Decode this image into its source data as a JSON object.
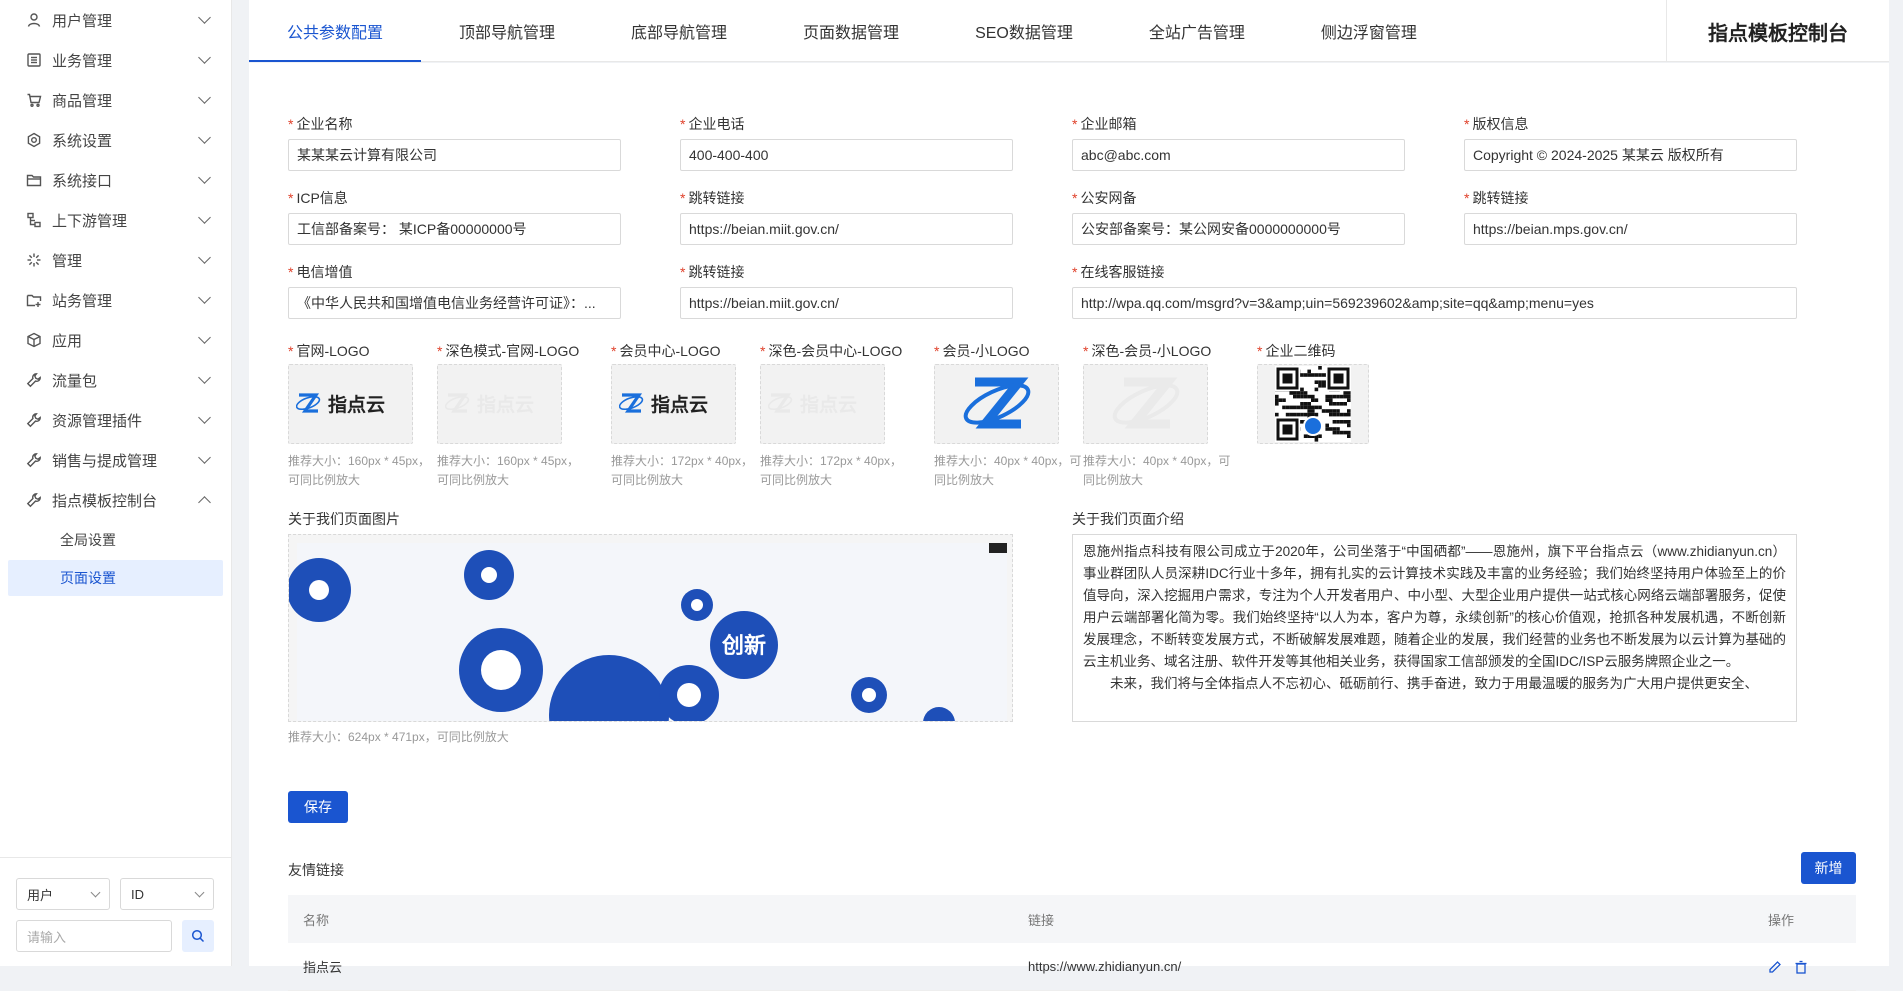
{
  "sidebar": {
    "items": [
      {
        "label": "用户管理",
        "icon": "user-icon"
      },
      {
        "label": "业务管理",
        "icon": "list-icon"
      },
      {
        "label": "商品管理",
        "icon": "cart-icon"
      },
      {
        "label": "系统设置",
        "icon": "settings-icon"
      },
      {
        "label": "系统接口",
        "icon": "folder-icon"
      },
      {
        "label": "上下游管理",
        "icon": "tree-icon"
      },
      {
        "label": "管理",
        "icon": "sparkle-icon"
      },
      {
        "label": "站务管理",
        "icon": "folder-plus-icon"
      },
      {
        "label": "应用",
        "icon": "cube-icon"
      },
      {
        "label": "流量包",
        "icon": "wrench-icon"
      },
      {
        "label": "资源管理插件",
        "icon": "wrench-icon"
      },
      {
        "label": "销售与提成管理",
        "icon": "wrench-icon"
      },
      {
        "label": "指点模板控制台",
        "icon": "wrench-icon"
      }
    ],
    "sub_items": [
      {
        "label": "全局设置"
      },
      {
        "label": "页面设置"
      }
    ],
    "filter": {
      "select1": "用户",
      "select2": "ID",
      "search_placeholder": "请输入"
    }
  },
  "tabs": [
    {
      "label": "公共参数配置"
    },
    {
      "label": "顶部导航管理"
    },
    {
      "label": "底部导航管理"
    },
    {
      "label": "页面数据管理"
    },
    {
      "label": "SEO数据管理"
    },
    {
      "label": "全站广告管理"
    },
    {
      "label": "侧边浮窗管理"
    }
  ],
  "console_title": "指点模板控制台",
  "form": {
    "company_name": {
      "label": "企业名称",
      "value": "某某某云计算有限公司"
    },
    "company_phone": {
      "label": "企业电话",
      "value": "400-400-400"
    },
    "company_email": {
      "label": "企业邮箱",
      "value": "abc@abc.com"
    },
    "copyright": {
      "label": "版权信息",
      "value": "Copyright © 2024-2025 某某云 版权所有"
    },
    "icp": {
      "label": "ICP信息",
      "value": "工信部备案号： 某ICP备00000000号"
    },
    "icp_link": {
      "label": "跳转链接",
      "value": "https://beian.miit.gov.cn/"
    },
    "police": {
      "label": "公安网备",
      "value": "公安部备案号：某公网安备0000000000号"
    },
    "police_link": {
      "label": "跳转链接",
      "value": "https://beian.mps.gov.cn/"
    },
    "telecom": {
      "label": "电信增值",
      "value": "《中华人民共和国增值电信业务经营许可证》：..."
    },
    "telecom_link": {
      "label": "跳转链接",
      "value": "https://beian.miit.gov.cn/"
    },
    "service_link": {
      "label": "在线客服链接",
      "value": "http://wpa.qq.com/msgrd?v=3&amp;uin=569239602&amp;site=qq&amp;menu=yes"
    }
  },
  "logos": [
    {
      "label": "官网-LOGO",
      "hint1": "推荐大小：160px * 45px，",
      "hint2": "可同比例放大",
      "logo_text": "指点云"
    },
    {
      "label": "深色模式-官网-LOGO",
      "hint1": "推荐大小：160px * 45px，",
      "hint2": "可同比例放大",
      "logo_text": "指点云"
    },
    {
      "label": "会员中心-LOGO",
      "hint1": "推荐大小：172px * 40px，",
      "hint2": "可同比例放大",
      "logo_text": "指点云"
    },
    {
      "label": "深色-会员中心-LOGO",
      "hint1": "推荐大小：172px * 40px，",
      "hint2": "可同比例放大",
      "logo_text": "指点云"
    },
    {
      "label": "会员-小LOGO",
      "hint1": "推荐大小：40px * 40px，可",
      "hint2": "同比例放大"
    },
    {
      "label": "深色-会员-小LOGO",
      "hint1": "推荐大小：40px * 40px，可",
      "hint2": "同比例放大"
    },
    {
      "label": "企业二维码"
    }
  ],
  "about": {
    "image_label": "关于我们页面图片",
    "image_hint": "推荐大小：624px * 471px，可同比例放大",
    "image_text": "创新",
    "text_label": "关于我们页面介绍",
    "text_p1": "恩施州指点科技有限公司成立于2020年，公司坐落于“中国硒都”——恩施州，旗下平台指点云（www.zhidianyun.cn）事业群团队人员深耕IDC行业十多年，拥有扎实的云计算技术实践及丰富的业务经验；我们始终坚持用户体验至上的价值导向，深入挖掘用户需求，专注为个人开发者用户、中小型、大型企业用户提供一站式核心网络云端部署服务，促使用户云端部署化简为零。我们始终坚持“以人为本，客户为尊，永续创新”的核心价值观，抢抓各种发展机遇，不断创新发展理念，不断转变发展方式，不断破解发展难题，随着企业的发展，我们经营的业务也不断发展为以云计算为基础的云主机业务、域名注册、软件开发等其他相关业务，获得国家工信部颁发的全国IDC/ISP云服务牌照企业之一。",
    "text_p2": "未来，我们将与全体指点人不忘初心、砥砺前行、携手奋进，致力于用最温暖的服务为广大用户提供更安全、"
  },
  "save_label": "保存",
  "friend_links": {
    "title": "友情链接",
    "add_label": "新增",
    "columns": [
      "名称",
      "链接",
      "操作"
    ],
    "rows": [
      {
        "name": "指点云",
        "link": "https://www.zhidianyun.cn/"
      }
    ]
  },
  "colors": {
    "accent": "#1a55d0",
    "required": "#e0412b"
  }
}
